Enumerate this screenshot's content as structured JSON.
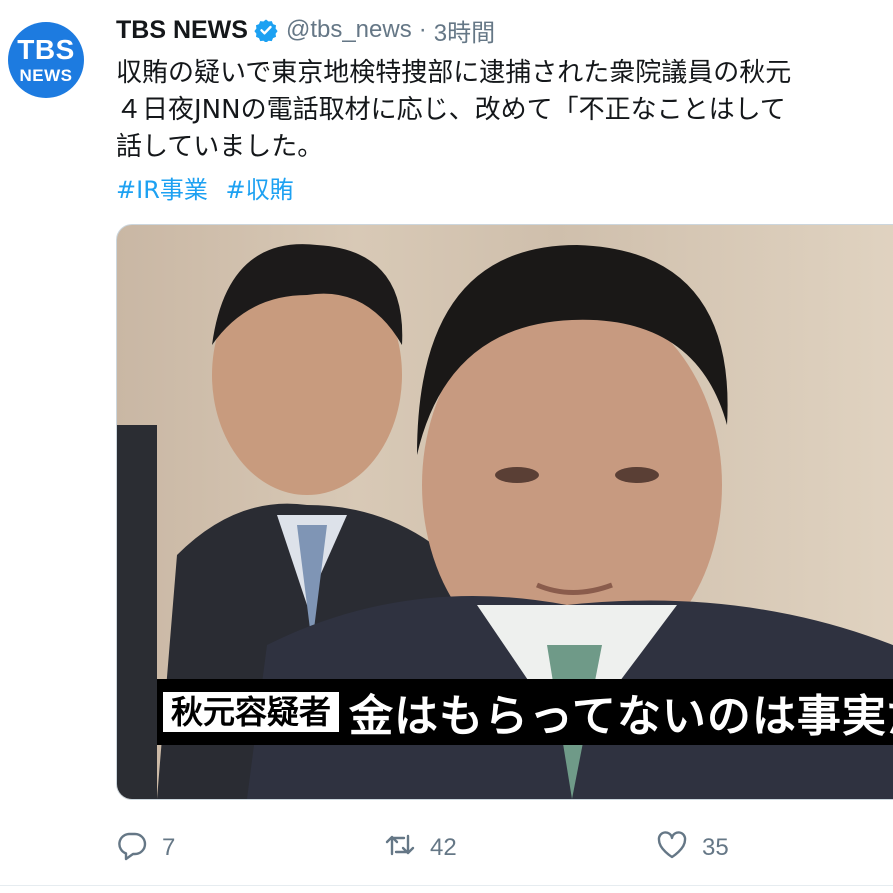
{
  "account": {
    "avatar_line1": "TBS",
    "avatar_line2": "NEWS",
    "display_name": "TBS NEWS",
    "verified": true,
    "handle": "@tbs_news",
    "separator": "·",
    "time": "3時間"
  },
  "tweet": {
    "lines": [
      "収賄の疑いで東京地検特捜部に逮捕された衆院議員の秋元",
      "４日夜JNNの電話取材に応じ、改めて「不正なことはして",
      "話していました。"
    ],
    "hashtags": [
      "#IR事業",
      "#収賄"
    ]
  },
  "media": {
    "caption_label": "秋元容疑者",
    "caption_text": "金はもらってないのは事実だ"
  },
  "actions": {
    "reply_count": "7",
    "retweet_count": "42",
    "like_count": "35"
  },
  "colors": {
    "accent": "#1da1f2",
    "muted": "#657786",
    "avatar_bg": "#1d7be0",
    "text": "#14171a"
  },
  "icons": {
    "verified": "verified-badge-icon",
    "reply": "reply-icon",
    "retweet": "retweet-icon",
    "like": "heart-icon"
  }
}
